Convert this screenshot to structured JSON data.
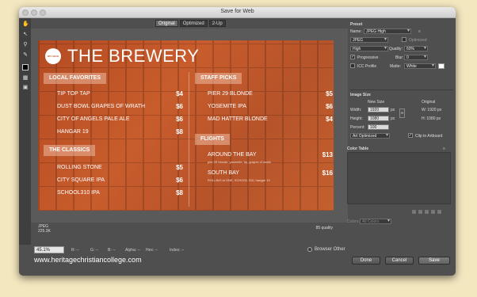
{
  "window": {
    "title": "Save for Web"
  },
  "tools": [
    "hand-icon",
    "slice-select-icon",
    "zoom-icon",
    "eyedropper-icon",
    "color-swatch",
    "toggle-slices-icon",
    "preview-icon"
  ],
  "tabs": [
    {
      "label": "Original"
    },
    {
      "label": "Optimized"
    },
    {
      "label": "2-Up"
    }
  ],
  "menu": {
    "brand": "THE BREWERY",
    "logo_text": "MY LOGO",
    "left": {
      "sections": [
        {
          "title": "LOCAL FAVORITES",
          "items": [
            {
              "name": "TIP TOP TAP",
              "price": "$4"
            },
            {
              "name": "DUST BOWL GRAPES OF WRATH",
              "price": "$6"
            },
            {
              "name": "CITY OF ANGELS PALE ALE",
              "price": "$6"
            },
            {
              "name": "HANGAR 19",
              "price": "$8"
            }
          ]
        },
        {
          "title": "THE CLASSICS",
          "items": [
            {
              "name": "ROLLING STONE",
              "price": "$5"
            },
            {
              "name": "CITY SQUARE IPA",
              "price": "$6"
            },
            {
              "name": "SCHOOL310 IPA",
              "price": "$8"
            }
          ]
        }
      ]
    },
    "right": {
      "sections": [
        {
          "title": "STAFF PICKS",
          "items": [
            {
              "name": "PIER 29 BLONDE",
              "price": "$5"
            },
            {
              "name": "YOSEMITE IPA",
              "price": "$6"
            },
            {
              "name": "MAD HATTER BLONDE",
              "price": "$4"
            }
          ]
        },
        {
          "title": "FLIGHTS",
          "items": [
            {
              "name": "AROUND THE BAY",
              "price": "$13",
              "sub": "pier 29 blonde, yosemite, tip, grapes of wrath"
            },
            {
              "name": "SOUTH BAY",
              "price": "$16",
              "sub": "ROLLING st ONE, SCHOOL 310, hangar 19"
            }
          ]
        }
      ]
    }
  },
  "info": {
    "format": "JPEG",
    "size": "225.3K",
    "quality": "85 quality"
  },
  "statusbar": {
    "zoom": "45.1%",
    "r": "R: --",
    "g": "G: --",
    "b": "B: --",
    "alpha": "Alpha: --",
    "hex": "Hex: --",
    "index": "Index: --",
    "browser_label": "Browser Other"
  },
  "buttons": {
    "done": "Done",
    "cancel": "Cancel",
    "save": "Save"
  },
  "preset": {
    "heading": "Preset",
    "name_label": "Name:",
    "name_value": "JPEG High",
    "format": "JPEG",
    "optimized_label": "Optimized",
    "quality_preset": "High",
    "quality_label": "Quality:",
    "quality_value": "60%",
    "progressive_label": "Progressive",
    "blur_label": "Blur:",
    "blur_value": "0",
    "icc_label": "ICC Profile",
    "matte_label": "Matte:",
    "matte_value": "White"
  },
  "image_size": {
    "heading": "Image Size",
    "new_size_label": "New Size",
    "width_label": "Width:",
    "width_value": "1920",
    "height_label": "Height:",
    "height_value": "1080",
    "unit": "px",
    "percent_label": "Percent:",
    "percent_value": "100",
    "resample": "Art Optimized",
    "original_label": "Original",
    "orig_w": "W: 1920 px",
    "orig_h": "H: 1080 px",
    "clip_label": "Clip to Artboard"
  },
  "color_table": {
    "heading": "Color Table",
    "colors_label": "Colors:",
    "colors_value": "All Colors"
  },
  "overlay": {
    "watermark": "www.heritagechristiancollege.com"
  },
  "colors": {
    "accent": "#c0582a",
    "dialog": "#4f4f4f",
    "page": "#f3e7bf"
  }
}
